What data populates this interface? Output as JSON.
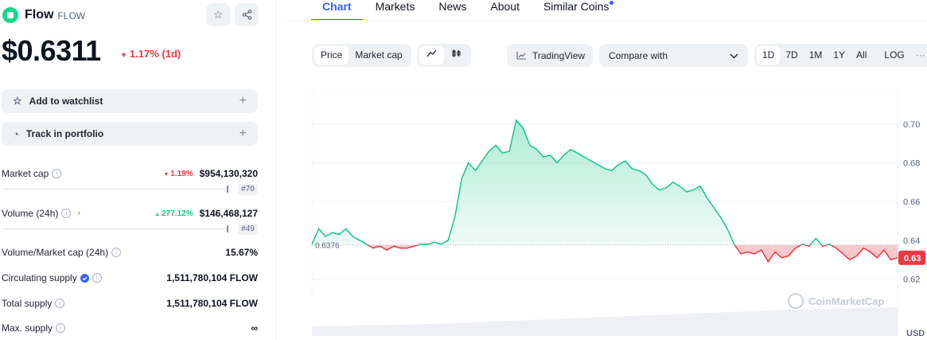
{
  "coin": {
    "name": "Flow",
    "symbol": "FLOW",
    "price": "$0.6311",
    "change": "1.17% (1d)"
  },
  "actions": {
    "watchlist": "Add to watchlist",
    "portfolio": "Track in portfolio",
    "plus": "+"
  },
  "stats": {
    "market_cap": {
      "label": "Market cap",
      "pct": "1.19%",
      "value": "$954,130,320",
      "rank": "#70"
    },
    "volume": {
      "label": "Volume (24h)",
      "pct": "277.12%",
      "value": "$146,468,127",
      "rank": "#49"
    },
    "vol_mcap": {
      "label": "Volume/Market cap (24h)",
      "value": "15.67%"
    },
    "circulating": {
      "label": "Circulating supply",
      "value": "1,511,780,104 FLOW"
    },
    "total": {
      "label": "Total supply",
      "value": "1,511,780,104 FLOW"
    },
    "max": {
      "label": "Max. supply",
      "value": "∞"
    }
  },
  "tabs": [
    "Chart",
    "Markets",
    "News",
    "About",
    "Similar Coins"
  ],
  "controls": {
    "price": "Price",
    "market_cap": "Market cap",
    "tradingview": "TradingView",
    "compare": "Compare with",
    "ranges": [
      "1D",
      "7D",
      "1M",
      "1Y",
      "All"
    ],
    "log": "LOG"
  },
  "colors": {
    "up": "#16c784",
    "down": "#ea3943",
    "accent": "#3861fb"
  },
  "icons": [
    "star-icon",
    "share-icon",
    "line-chart-icon",
    "candle-icon",
    "trend-icon",
    "chevron-down-icon",
    "info-icon",
    "verified-icon"
  ],
  "chart_data": {
    "type": "area",
    "baseline": 0.6376,
    "baseline_label": "0.6376",
    "current_label": "0.63",
    "ylim": [
      0.612,
      0.718
    ],
    "yticks": [
      "0.70",
      "0.68",
      "0.66",
      "0.64",
      "0.62"
    ],
    "ytick_values": [
      0.7,
      0.68,
      0.66,
      0.64,
      0.62
    ],
    "watermark": "CoinMarketCap",
    "currency": "USD",
    "values": [
      0.638,
      0.646,
      0.642,
      0.644,
      0.643,
      0.646,
      0.642,
      0.64,
      0.638,
      0.636,
      0.637,
      0.635,
      0.637,
      0.636,
      0.636,
      0.637,
      0.638,
      0.638,
      0.639,
      0.638,
      0.64,
      0.652,
      0.672,
      0.68,
      0.676,
      0.681,
      0.686,
      0.689,
      0.685,
      0.686,
      0.702,
      0.698,
      0.689,
      0.687,
      0.683,
      0.684,
      0.68,
      0.684,
      0.687,
      0.685,
      0.683,
      0.681,
      0.679,
      0.677,
      0.676,
      0.679,
      0.681,
      0.677,
      0.676,
      0.674,
      0.669,
      0.666,
      0.667,
      0.67,
      0.668,
      0.665,
      0.666,
      0.668,
      0.662,
      0.657,
      0.652,
      0.646,
      0.638,
      0.633,
      0.634,
      0.633,
      0.635,
      0.629,
      0.634,
      0.631,
      0.632,
      0.636,
      0.638,
      0.637,
      0.641,
      0.637,
      0.638,
      0.636,
      0.633,
      0.63,
      0.632,
      0.636,
      0.634,
      0.631,
      0.635,
      0.63,
      0.631
    ]
  }
}
